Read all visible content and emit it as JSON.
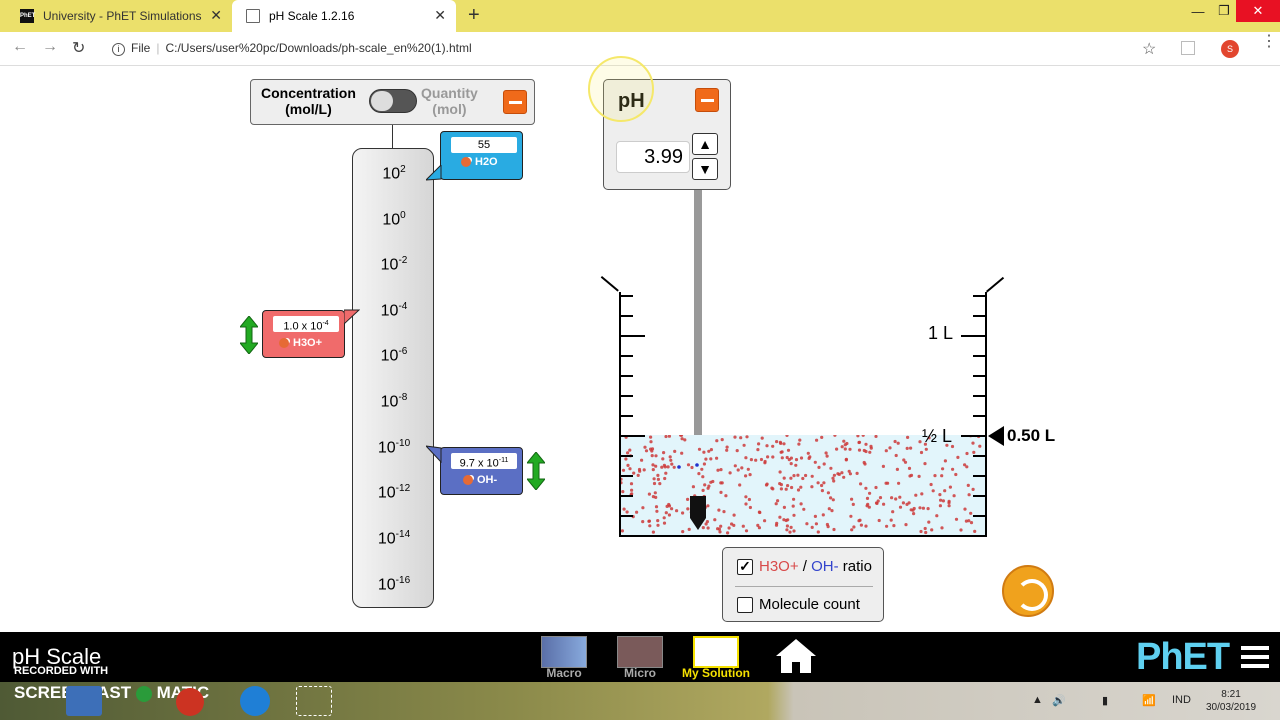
{
  "browser": {
    "tabs": [
      {
        "title": "University - PhET Simulations",
        "active": false
      },
      {
        "title": "pH Scale 1.2.16",
        "active": true
      }
    ],
    "url_prefix": "File",
    "url": "C:/Users/user%20pc/Downloads/ph-scale_en%20(1).html",
    "profile_initial": "S"
  },
  "sim": {
    "graph_toggle": {
      "left_label_line1": "Concentration",
      "left_label_line2": "(mol/L)",
      "right_label_line1": "Quantity",
      "right_label_line2": "(mol)"
    },
    "scale_ticks": [
      {
        "base": "10",
        "exp": "2"
      },
      {
        "base": "10",
        "exp": "0"
      },
      {
        "base": "10",
        "exp": "-2"
      },
      {
        "base": "10",
        "exp": "-4"
      },
      {
        "base": "10",
        "exp": "-6"
      },
      {
        "base": "10",
        "exp": "-8"
      },
      {
        "base": "10",
        "exp": "-10"
      },
      {
        "base": "10",
        "exp": "-12"
      },
      {
        "base": "10",
        "exp": "-14"
      },
      {
        "base": "10",
        "exp": "-16"
      }
    ],
    "h2o": {
      "value": "55",
      "label": "H2O"
    },
    "h3o": {
      "value": "1.0 x 10",
      "value_exp": "-4",
      "label": "H3O+"
    },
    "oh": {
      "value": "9.7 x 10",
      "value_exp": "-11",
      "label": "OH-"
    },
    "ph_meter": {
      "title": "pH",
      "value": "3.99"
    },
    "beaker": {
      "mark_1l": "1 L",
      "mark_half": "½ L",
      "volume": "0.50 L"
    },
    "ratio_panel": {
      "ratio_checked": true,
      "h3o_text": "H3O+",
      "slash": " / ",
      "oh_text": "OH-",
      "ratio_text": " ratio",
      "molecule_count_label": "Molecule count",
      "molecule_count_checked": false
    }
  },
  "footer": {
    "title": "pH Scale",
    "screens": [
      {
        "label": "Macro",
        "active": false
      },
      {
        "label": "Micro",
        "active": false
      },
      {
        "label": "My Solution",
        "active": true
      }
    ],
    "logo": "PhET"
  },
  "overlay": {
    "recorded_with": "RECORDED WITH",
    "brand": "SCREENCAST",
    "brand2": "MATIC"
  },
  "taskbar": {
    "lang": "IND",
    "time": "8:21",
    "date": "30/03/2019"
  },
  "colors": {
    "tabbar": "#ebe06b",
    "h2o_callout": "#29abe2",
    "h3o_callout": "#f06b6b",
    "oh_callout": "#5b6fc4",
    "minus_button": "#f06a1a",
    "solution": "#e2f5fb",
    "reset": "#f0a21d",
    "active_screen": "#f5e100"
  }
}
